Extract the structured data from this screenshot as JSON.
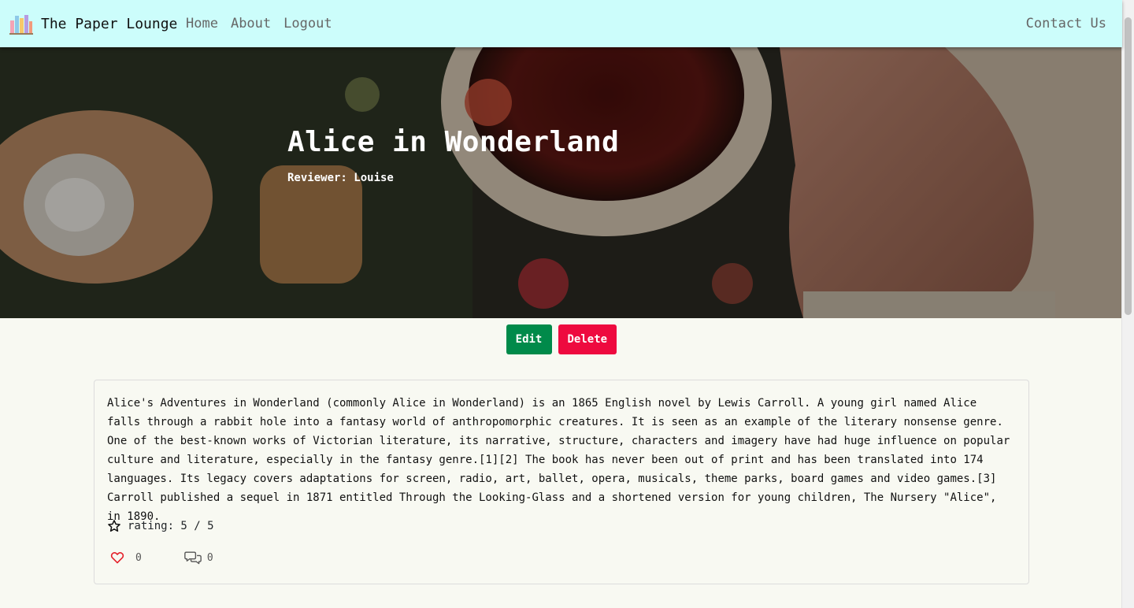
{
  "nav": {
    "brand": "The Paper Lounge",
    "brand_icon": "books-icon",
    "links": [
      "Home",
      "About",
      "Logout"
    ],
    "contact": "Contact Us"
  },
  "hero": {
    "title": "Alice in Wonderland",
    "reviewer": "Reviewer: Louise"
  },
  "buttons": {
    "edit": "Edit",
    "delete": "Delete"
  },
  "review": {
    "text": "Alice's Adventures in Wonderland (commonly Alice in Wonderland) is an 1865 English novel by Lewis Carroll. A young girl named Alice falls through a rabbit hole into a fantasy world of anthropomorphic creatures. It is seen as an example of the literary nonsense genre. One of the best-known works of Victorian literature, its narrative, structure, characters and imagery have had huge influence on popular culture and literature, especially in the fantasy genre.[1][2] The book has never been out of print and has been translated into 174 languages. Its legacy covers adaptations for screen, radio, art, ballet, opera, musicals, theme parks, board games and video games.[3] Carroll published a sequel in 1871 entitled Through the Looking-Glass and a shortened version for young children, The Nursery \"Alice\", in 1890.",
    "rating": "rating: 5 / 5",
    "likes": "0",
    "comments": "0"
  },
  "colors": {
    "navbar": "#ccfdfb",
    "edit": "#008a4a",
    "delete": "#ee0a3f",
    "like_icon": "#e4202a",
    "page_bg": "#f8f9f2"
  }
}
